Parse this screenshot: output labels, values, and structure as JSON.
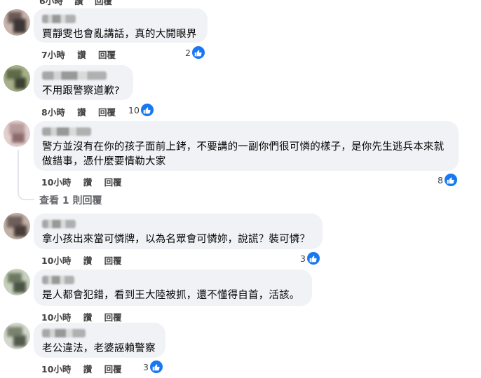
{
  "top_partial": {
    "time": "6小時",
    "like": "讚",
    "reply": "回覆"
  },
  "comments": [
    {
      "text": "賈靜雯也會亂講話，真的大開眼界",
      "time": "7小時",
      "like": "讚",
      "reply": "回覆",
      "reactions": "2",
      "avatar_colors": [
        "#6b5a55",
        "#c8b4ac",
        "#3c3535"
      ]
    },
    {
      "text": "不用跟警察道歉?",
      "time": "8小時",
      "like": "讚",
      "reply": "回覆",
      "reactions": "10",
      "avatar_colors": [
        "#5f6a48",
        "#a7b08a",
        "#3b4030"
      ]
    },
    {
      "text": "警方並沒有在你的孩子面前上銬，不要講的一副你們很可憐的樣子，是你先生逃兵本來就做錯事，憑什麼要情勒大家",
      "time": "10小時",
      "like": "讚",
      "reply": "回覆",
      "reactions": "8",
      "avatar_colors": [
        "#b79a9a",
        "#e2d0cf",
        "#8b6a6c"
      ]
    },
    {
      "text": "拿小孩出來當可憐牌，以為名眾會可憐妳，說謊？裝可憐？",
      "time": "10小時",
      "like": "讚",
      "reply": "回覆",
      "reactions": "3",
      "avatar_colors": [
        "#6f5f5a",
        "#c2b0a6",
        "#483c38"
      ]
    },
    {
      "text": "是人都會犯錯，看到王大陸被抓，還不懂得自首，活該。",
      "time": "10小時",
      "like": "讚",
      "reply": "回覆",
      "reactions": "",
      "avatar_colors": [
        "#6d7a63",
        "#c7d0bd",
        "#4a5344"
      ]
    },
    {
      "text": "老公違法，老婆誣賴警察",
      "time": "10小時",
      "like": "讚",
      "reply": "回覆",
      "reactions": "3",
      "avatar_colors": [
        "#7a8270",
        "#d3d8cc",
        "#525a4b"
      ]
    }
  ],
  "view_replies": "查看 1 則回覆",
  "icons": {
    "like": "thumbs-up-icon"
  },
  "colors": {
    "like_blue": "#1877f2",
    "bubble": "#f0f2f5"
  }
}
